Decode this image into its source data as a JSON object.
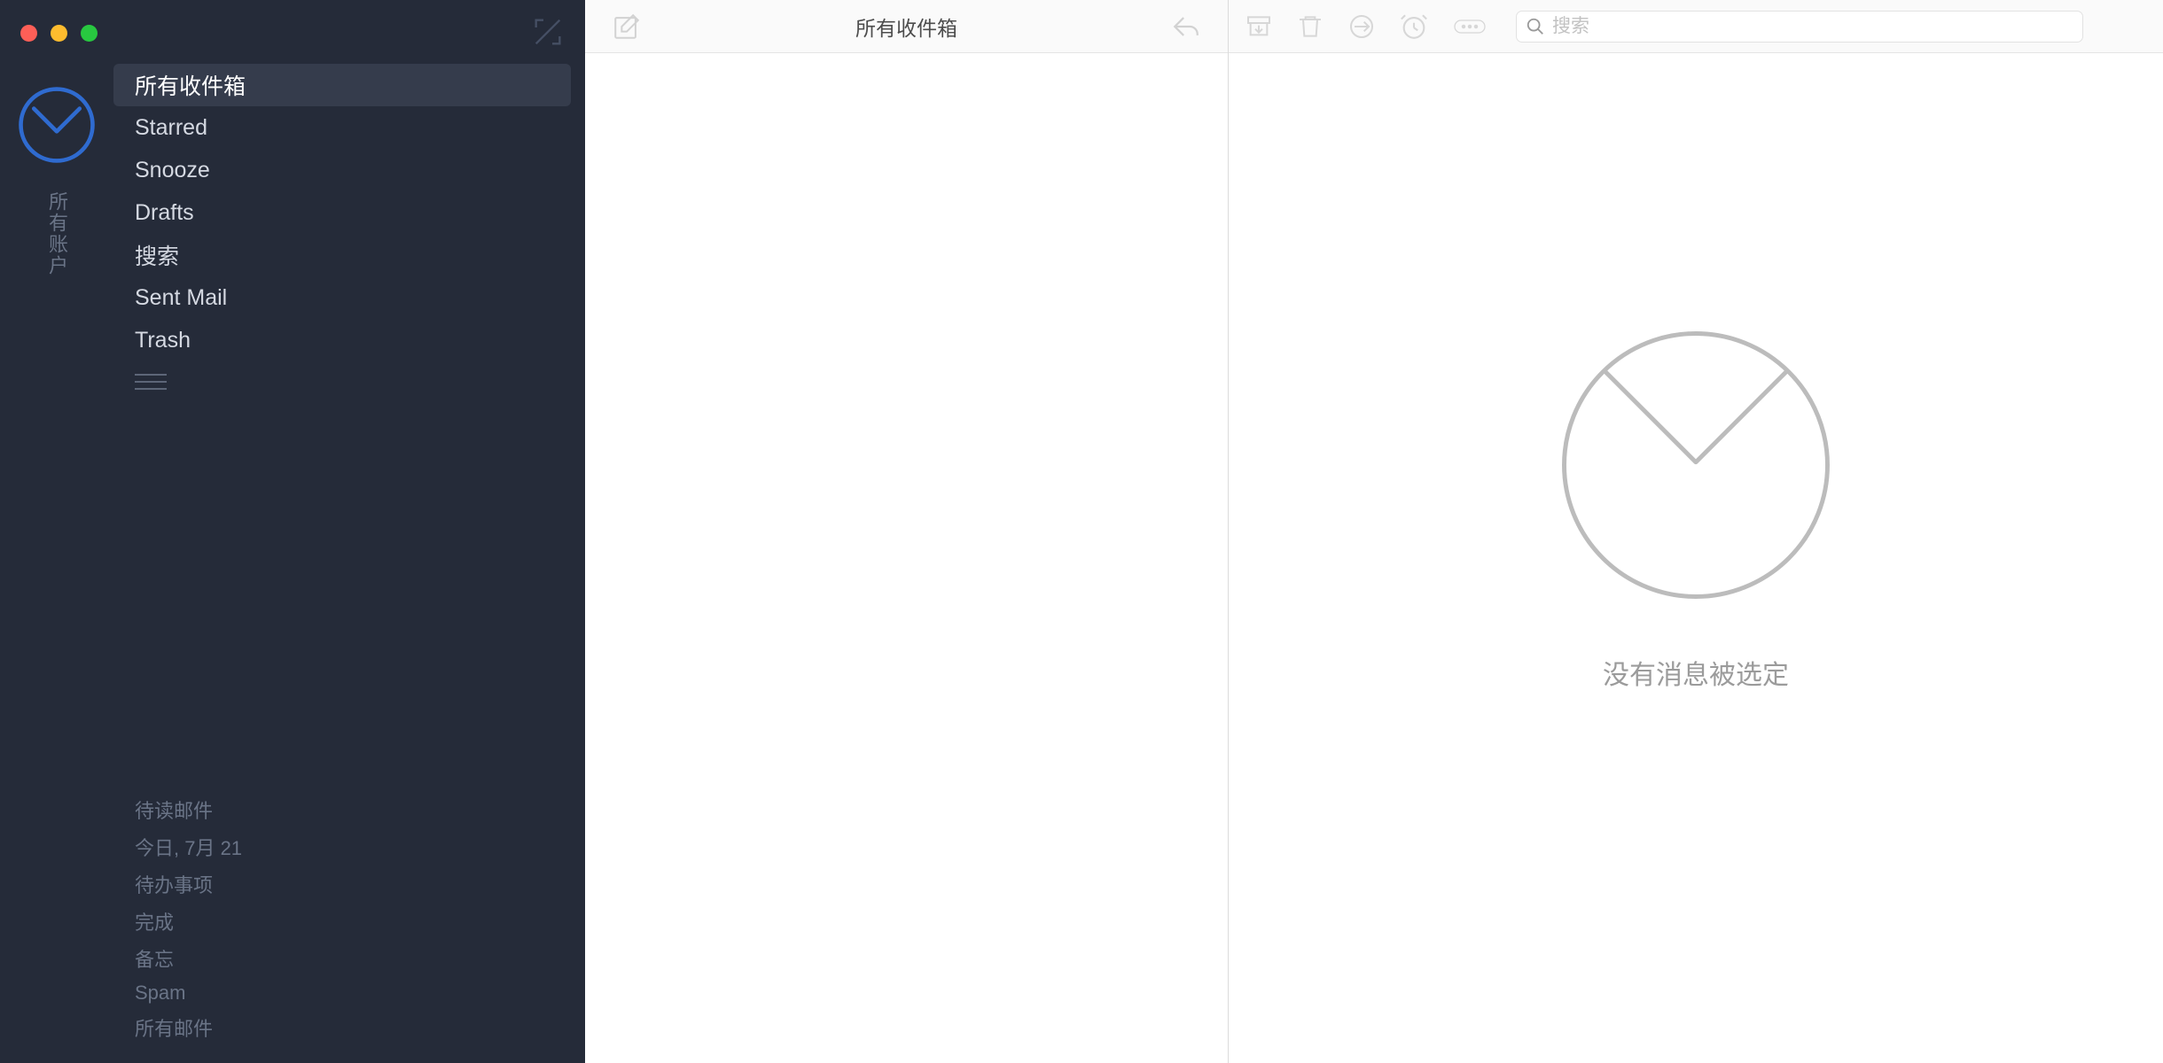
{
  "sidebar": {
    "account_label": "所有账户",
    "folders": [
      {
        "label": "所有收件箱",
        "selected": true
      },
      {
        "label": "Starred",
        "selected": false
      },
      {
        "label": "Snooze",
        "selected": false
      },
      {
        "label": "Drafts",
        "selected": false
      },
      {
        "label": "搜索",
        "selected": false
      },
      {
        "label": "Sent Mail",
        "selected": false
      },
      {
        "label": "Trash",
        "selected": false
      }
    ],
    "bottom": [
      {
        "label": "待读邮件"
      },
      {
        "label": "今日, 7月 21"
      },
      {
        "label": "待办事项"
      },
      {
        "label": "完成"
      },
      {
        "label": "备忘"
      },
      {
        "label": "Spam"
      },
      {
        "label": "所有邮件"
      }
    ]
  },
  "list": {
    "title": "所有收件箱"
  },
  "read": {
    "search_placeholder": "搜索",
    "empty_text": "没有消息被选定"
  }
}
